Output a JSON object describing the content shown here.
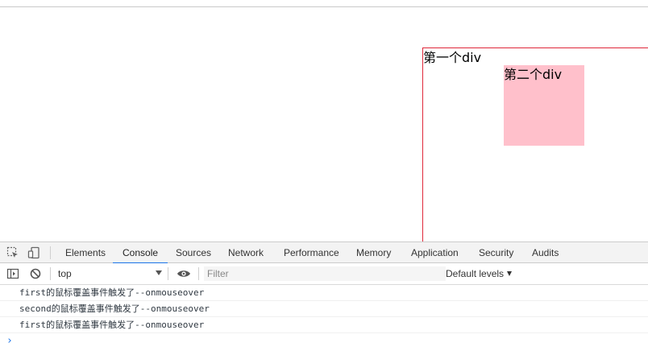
{
  "page": {
    "first_div_text": "第一个div",
    "second_div_text": "第二个div"
  },
  "devtools": {
    "tabs": [
      {
        "label": "Elements"
      },
      {
        "label": "Console",
        "active": true
      },
      {
        "label": "Sources"
      },
      {
        "label": "Network"
      },
      {
        "label": "Performance"
      },
      {
        "label": "Memory"
      },
      {
        "label": "Application"
      },
      {
        "label": "Security"
      },
      {
        "label": "Audits"
      }
    ],
    "toolbar": {
      "context": "top",
      "filter_placeholder": "Filter",
      "levels_label": "Default levels"
    },
    "console_logs": [
      "first的鼠标覆盖事件触发了--onmouseover",
      "second的鼠标覆盖事件触发了--onmouseover",
      "first的鼠标覆盖事件触发了--onmouseover"
    ],
    "prompt_symbol": "›",
    "colors": {
      "accent": "#1a73e8",
      "first_div_border": "#e0283a",
      "second_div_bg": "#ffc0cb"
    }
  }
}
